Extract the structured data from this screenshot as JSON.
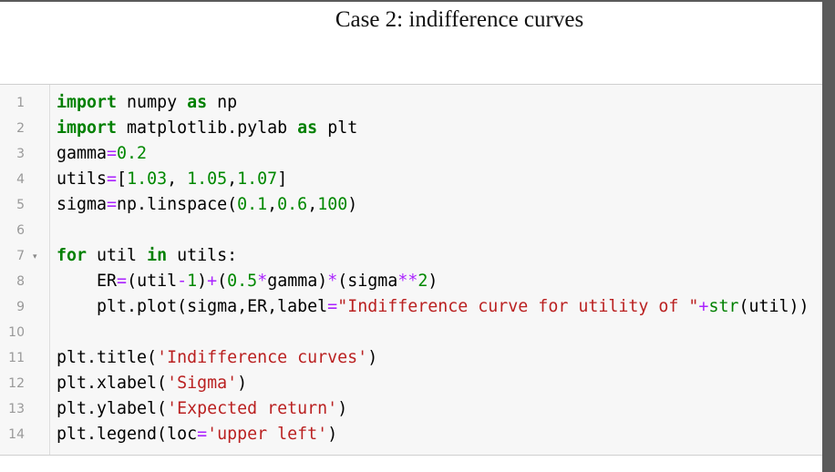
{
  "heading": "Case 2: indifference curves",
  "cell": {
    "lines": [
      {
        "no": "1",
        "tokens": [
          [
            "kw",
            "import"
          ],
          [
            "",
            "numpy"
          ],
          [
            "kw",
            "as"
          ],
          [
            "",
            "np"
          ]
        ],
        "sep": [
          " ",
          " ",
          " "
        ]
      },
      {
        "no": "2"
      },
      {
        "no": "3"
      },
      {
        "no": "4"
      },
      {
        "no": "5"
      },
      {
        "no": "6"
      },
      {
        "no": "7"
      },
      {
        "no": "8"
      },
      {
        "no": "9"
      },
      {
        "no": "10"
      },
      {
        "no": "11"
      },
      {
        "no": "12"
      },
      {
        "no": "13"
      },
      {
        "no": "14"
      }
    ],
    "code": [
      [
        [
          "kw",
          "import"
        ],
        [
          "",
          " numpy "
        ],
        [
          "kw",
          "as"
        ],
        [
          "",
          " np"
        ]
      ],
      [
        [
          "kw",
          "import"
        ],
        [
          "",
          " matplotlib.pylab "
        ],
        [
          "kw",
          "as"
        ],
        [
          "",
          " plt"
        ]
      ],
      [
        [
          "",
          "gamma"
        ],
        [
          "op",
          "="
        ],
        [
          "num",
          "0.2"
        ]
      ],
      [
        [
          "",
          "utils"
        ],
        [
          "op",
          "="
        ],
        [
          "",
          "["
        ],
        [
          "num",
          "1.03"
        ],
        [
          "",
          ", "
        ],
        [
          "num",
          "1.05"
        ],
        [
          "",
          ","
        ],
        [
          "num",
          "1.07"
        ],
        [
          "",
          "]"
        ]
      ],
      [
        [
          "",
          "sigma"
        ],
        [
          "op",
          "="
        ],
        [
          "",
          "np.linspace("
        ],
        [
          "num",
          "0.1"
        ],
        [
          "",
          ","
        ],
        [
          "num",
          "0.6"
        ],
        [
          "",
          ","
        ],
        [
          "num",
          "100"
        ],
        [
          "",
          ")"
        ]
      ],
      [],
      [
        [
          "kw",
          "for"
        ],
        [
          "",
          " util "
        ],
        [
          "kw",
          "in"
        ],
        [
          "",
          " utils:"
        ]
      ],
      [
        [
          "",
          "    ER"
        ],
        [
          "op",
          "="
        ],
        [
          "",
          "(util"
        ],
        [
          "op",
          "-"
        ],
        [
          "num",
          "1"
        ],
        [
          "",
          ")"
        ],
        [
          "op",
          "+"
        ],
        [
          "",
          "("
        ],
        [
          "num",
          "0.5"
        ],
        [
          "op",
          "*"
        ],
        [
          "",
          "gamma)"
        ],
        [
          "op",
          "*"
        ],
        [
          "",
          "(sigma"
        ],
        [
          "op",
          "**"
        ],
        [
          "num",
          "2"
        ],
        [
          "",
          ")"
        ]
      ],
      [
        [
          "",
          "    plt.plot(sigma,ER,label"
        ],
        [
          "op",
          "="
        ],
        [
          "str",
          "\"Indifference curve for utility of \""
        ],
        [
          "op",
          "+"
        ],
        [
          "bi",
          "str"
        ],
        [
          "",
          "(util))"
        ]
      ],
      [],
      [
        [
          "",
          "plt.title("
        ],
        [
          "str",
          "'Indifference curves'"
        ],
        [
          "",
          ")"
        ]
      ],
      [
        [
          "",
          "plt.xlabel("
        ],
        [
          "str",
          "'Sigma'"
        ],
        [
          "",
          ")"
        ]
      ],
      [
        [
          "",
          "plt.ylabel("
        ],
        [
          "str",
          "'Expected return'"
        ],
        [
          "",
          ")"
        ]
      ],
      [
        [
          "",
          "plt.legend(loc"
        ],
        [
          "op",
          "="
        ],
        [
          "str",
          "'upper left'"
        ],
        [
          "",
          ")"
        ]
      ]
    ],
    "fold_marker": "▾",
    "fold_line": 7
  },
  "icons": {
    "fold": "caret-down-icon"
  }
}
